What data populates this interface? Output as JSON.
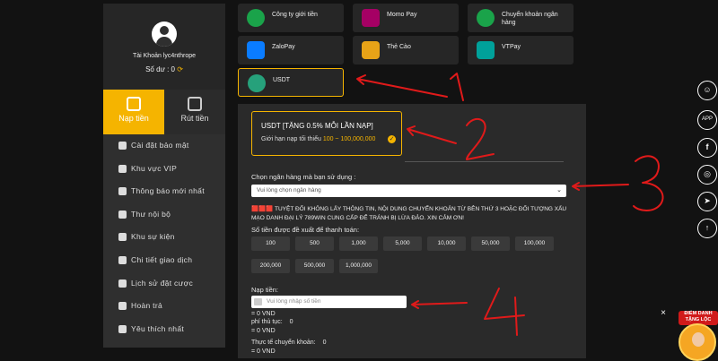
{
  "account": {
    "username": "Tài Khoản lyc4nthrope",
    "balance_label": "Số dư : 0",
    "refresh_icon": "refresh-icon"
  },
  "tabs": [
    {
      "label": "Nạp tiền",
      "icon": "deposit-icon"
    },
    {
      "label": "Rút tiền",
      "icon": "withdraw-icon"
    }
  ],
  "menu": [
    {
      "label": "Cài đặt bảo mật",
      "icon": "users-icon"
    },
    {
      "label": "Khu vực VIP",
      "icon": "crown-icon"
    },
    {
      "label": "Thông báo mới nhất",
      "icon": "megaphone-icon"
    },
    {
      "label": "Thư nội bộ",
      "icon": "mail-icon"
    },
    {
      "label": "Khu sự kiện",
      "icon": "trophy-icon"
    },
    {
      "label": "Chi tiết giao dịch",
      "icon": "list-icon"
    },
    {
      "label": "Lịch sử đặt cược",
      "icon": "edit-icon"
    },
    {
      "label": "Hoàn trả",
      "icon": "refund-icon"
    },
    {
      "label": "Yêu thích nhất",
      "icon": "heart-icon"
    }
  ],
  "payments": [
    {
      "label": "Công ty giới tiền",
      "icon": "globe-icon",
      "color": "#1aa34a"
    },
    {
      "label": "Momo Pay",
      "icon": "momo-icon",
      "color": "#a50064"
    },
    {
      "label": "Chuyển khoản ngân hàng",
      "icon": "bank-globe-icon",
      "color": "#1aa34a"
    },
    {
      "label": "ZaloPay",
      "icon": "zalopay-icon",
      "color": "#0a7cff"
    },
    {
      "label": "Thẻ Cào",
      "icon": "card-icon",
      "color": "#e8a317"
    },
    {
      "label": "VTPay",
      "icon": "vtpay-icon",
      "color": "#00a19a"
    },
    {
      "label": "USDT",
      "icon": "tether-icon",
      "color": "#26a17b"
    }
  ],
  "form": {
    "promo_title": "USDT [TẶNG 0.5% MỖI LẦN NẠP]",
    "promo_limit_label": "Giới hạn nạp tối thiểu",
    "promo_limit_range": "100 ~ 100,000,000",
    "bank_label": "Chọn ngân hàng mà bạn sử dụng :",
    "bank_placeholder": "Vui lòng chọn ngân hàng",
    "warning_flags": "🟥🟥🟥",
    "warning_text": "TUYỆT ĐỐI KHÔNG LẤY THÔNG TIN, NỘI DUNG CHUYỂN KHOẢN TỪ BÊN THỨ 3 HOẶC ĐỐI TƯỢNG XẤU MẠO DANH ĐẠI LÝ 789WIN CUNG CẤP ĐỂ TRÁNH BỊ LỪA ĐẢO. XIN CẢM ƠN!",
    "suggest_label": "Số tiền được đề xuất để thanh toán:",
    "amounts": [
      "100",
      "500",
      "1,000",
      "5,000",
      "10,000",
      "50,000",
      "100,000",
      "200,000",
      "500,000",
      "1,000,000"
    ],
    "deposit_label": "Nạp tiền:",
    "deposit_placeholder": "Vui lòng nhập số tiền",
    "equals_vnd_1": "= 0 VND",
    "fee_label": "phí thủ tục:",
    "fee_value": "0",
    "equals_vnd_2": "= 0 VND",
    "actual_label": "Thực tế chuyển khoản:",
    "actual_value": "0",
    "equals_vnd_3": "= 0 VND"
  },
  "social": [
    {
      "icon": "support-icon"
    },
    {
      "icon": "app-icon",
      "label": "APP"
    },
    {
      "icon": "facebook-icon",
      "label": "f"
    },
    {
      "icon": "instagram-icon"
    },
    {
      "icon": "telegram-icon"
    },
    {
      "icon": "arrow-up-icon",
      "label": "↑"
    }
  ],
  "promo_badge": {
    "title": "ĐIỂM DANH TẶNG LỘC"
  },
  "annotations": {
    "color": "#e01a1a",
    "numbers": [
      "1",
      "2",
      "3",
      "4"
    ]
  }
}
